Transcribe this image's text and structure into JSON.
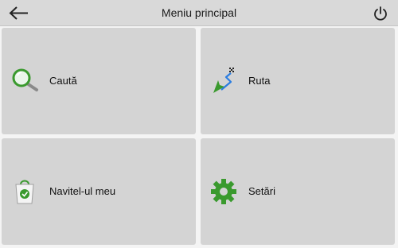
{
  "header": {
    "title": "Meniu principal",
    "back_icon": "arrow-left-icon",
    "power_icon": "power-icon"
  },
  "menu": {
    "items": [
      {
        "label": "Caută",
        "icon": "magnifier-icon"
      },
      {
        "label": "Ruta",
        "icon": "route-arrow-icon"
      },
      {
        "label": "Navitel-ul meu",
        "icon": "shopping-bag-icon"
      },
      {
        "label": "Setări",
        "icon": "gear-icon"
      }
    ]
  },
  "colors": {
    "tile_bg": "#d4d4d4",
    "header_bg": "#d9d9d9",
    "accent_green": "#3a9a2e",
    "accent_blue": "#2a7de1"
  }
}
